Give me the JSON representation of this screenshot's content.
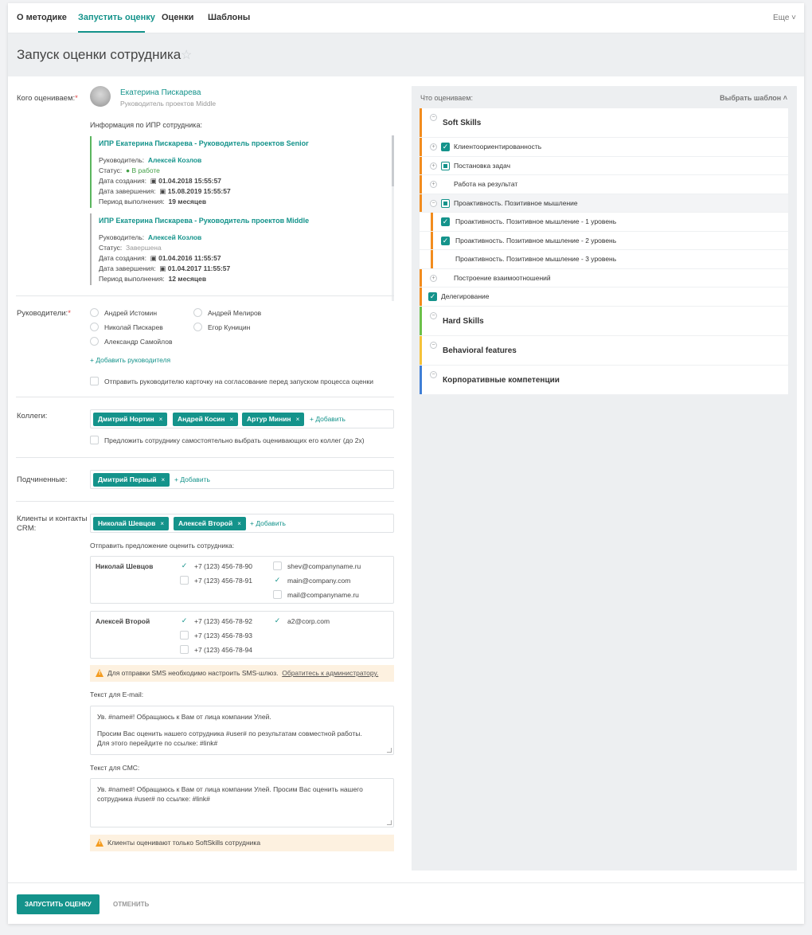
{
  "nav": {
    "tabs": [
      "О методике",
      "Запустить оценку",
      "Оценки",
      "Шаблоны"
    ],
    "more": "Еще ˅"
  },
  "page": {
    "title": "Запуск оценки сотрудника",
    "star": "☆"
  },
  "employee": {
    "label": "Кого оцениваем:",
    "required_mark": "*",
    "name": "Екатерина Пискарева",
    "position": "Руководитель проектов Middle",
    "ipr_heading": "Информация по ИПР сотрудника:"
  },
  "ipr": [
    {
      "title": "ИПР Екатерина Пискарева - Руководитель проектов Senior",
      "manager_label": "Руководитель:",
      "manager": "Алексей Козлов",
      "status_label": "Статус:",
      "status": "В работе",
      "created_label": "Дата создания:",
      "created": "01.04.2018 15:55:57",
      "finished_label": "Дата завершения:",
      "finished": "15.08.2019 15:55:57",
      "period_label": "Период выполнения:",
      "period": "19 месяцев"
    },
    {
      "title": "ИПР Екатерина Пискарева - Руководитель проектов Middle",
      "manager_label": "Руководитель:",
      "manager": "Алексей Козлов",
      "status_label": "Статус:",
      "status": "Завершена",
      "created_label": "Дата создания:",
      "created": "01.04.2016 11:55:57",
      "finished_label": "Дата завершения:",
      "finished": "01.04.2017 11:55:57",
      "period_label": "Период выполнения:",
      "period": "12 месяцев"
    }
  ],
  "managers": {
    "label": "Руководители:",
    "options": [
      "Андрей Истомин",
      "Андрей Мелиров",
      "Николай Пискарев",
      "Егор Куницин",
      "Александр Самойлов"
    ],
    "add_link": "+ Добавить руководителя",
    "approval_checkbox": "Отправить руководителю карточку на согласование перед запуском процесса оценки"
  },
  "colleagues": {
    "label": "Коллеги:",
    "chips": [
      "Дмитрий Нортин",
      "Андрей Косин",
      "Артур Минин"
    ],
    "add": "+ Добавить",
    "self_select_checkbox": "Предложить сотруднику самостоятельно выбрать оценивающих его коллег (до 2х)"
  },
  "subordinates": {
    "label": "Подчиненные:",
    "chips": [
      "Дмитрий Первый"
    ],
    "add": "+ Добавить"
  },
  "clients": {
    "label": "Клиенты и контакты CRM:",
    "chips": [
      "Николай Шевцов",
      "Алексей Второй"
    ],
    "add": "+ Добавить",
    "send_label": "Отправить предложение оценить сотрудника:",
    "contacts": [
      {
        "name": "Николай Шевцов",
        "phones": [
          {
            "v": "+7 (123) 456-78-90",
            "on": true
          },
          {
            "v": "+7 (123) 456-78-91",
            "on": false
          }
        ],
        "emails": [
          {
            "v": "shev@companyname.ru",
            "on": false
          },
          {
            "v": "main@company.com",
            "on": true
          },
          {
            "v": "mail@companyname.ru",
            "on": false
          }
        ]
      },
      {
        "name": "Алексей Второй",
        "phones": [
          {
            "v": "+7 (123) 456-78-92",
            "on": true
          },
          {
            "v": "+7 (123) 456-78-93",
            "on": false
          },
          {
            "v": "+7 (123) 456-78-94",
            "on": false
          }
        ],
        "emails": [
          {
            "v": "a2@corp.com",
            "on": true
          }
        ]
      }
    ],
    "sms_warning": "Для отправки SMS необходимо настроить SMS-шлюз.",
    "sms_warning_link": "Обратитесь к администратору.",
    "email_text_label": "Текст для E-mail:",
    "email_text_line1": "Ув. #name#! Обращаюсь к Вам от лица компании Улей.",
    "email_text_line2": "Просим Вас оценить нашего сотрудника #user# по результатам совместной работы.",
    "email_text_line3": "Для этого перейдите по ссылке: #link#",
    "sms_text_label": "Текст для СМС:",
    "sms_text_line1": "Ув. #name#! Обращаюсь к Вам от лица компании Улей. Просим Вас оценить нашего",
    "sms_text_line2": "сотрудника #user# по ссылке: #link#",
    "softskills_warning": "Клиенты оценивают только SoftSkills сотрудника"
  },
  "competencies": {
    "header": "Что оцениваем:",
    "template": "Выбрать шаблон ˄",
    "colors": {
      "soft": "#f28c1e",
      "hard": "#6cc04a",
      "behavioral": "#f5c23a",
      "corporate": "#3f7fd6"
    },
    "soft_skills": "Soft Skills",
    "items": [
      "Клиентоориентированность",
      "Постановка задач",
      "Работа на результат",
      "Проактивность. Позитивное мышление"
    ],
    "sub_items": [
      "Проактивность. Позитивное мышление - 1 уровень",
      "Проактивность. Позитивное мышление - 2 уровень",
      "Проактивность. Позитивное мышление - 3 уровень"
    ],
    "items2": [
      "Построение взаимоотношений",
      "Делегирование"
    ],
    "hard_skills": "Hard Skills",
    "behavioral": "Behavioral features",
    "corporate": "Корпоративные компетенции"
  },
  "footer": {
    "run": "ЗАПУСТИТЬ ОЦЕНКУ",
    "cancel": "ОТМЕНИТЬ"
  }
}
